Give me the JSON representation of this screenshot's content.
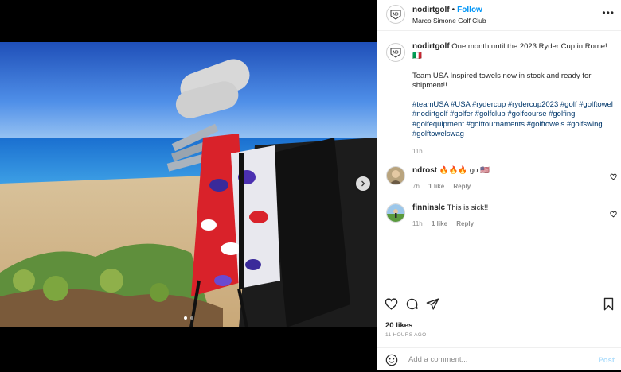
{
  "header": {
    "username": "nodirtgolf",
    "follow_label": "Follow",
    "location": "Marco Simone Golf Club",
    "more_label": "•••"
  },
  "avatar": {
    "monogram": "ND"
  },
  "caption": {
    "username": "nodirtgolf",
    "line1": "One month until the 2023 Ryder Cup in Rome! 🇮🇹",
    "line2": "Team USA Inspired towels now in stock and ready for shipment!!",
    "hashtags": "#teamUSA #USA #rydercup #rydercup2023 #golf #golftowel #nodirtgolf #golfer #golfclub #golfcourse #golfing #golfequipment #golftournaments #golftowels #golfswing #golftowelswag",
    "time": "11h"
  },
  "comments": [
    {
      "username": "ndrost",
      "text": "🔥🔥🔥 go 🇺🇸",
      "time": "7h",
      "likes": "1 like",
      "reply": "Reply"
    },
    {
      "username": "finninslc",
      "text": "This is sick!!",
      "time": "11h",
      "likes": "1 like",
      "reply": "Reply"
    }
  ],
  "post": {
    "likes": "20 likes",
    "time_ago": "11 HOURS AGO"
  },
  "add_comment": {
    "placeholder": "Add a comment...",
    "post_label": "Post"
  },
  "colors": {
    "link_blue": "#0095f6",
    "hashtag_blue": "#00376b",
    "muted": "#8e8e8e",
    "post_disabled": "#b2dffc"
  },
  "carousel": {
    "slide_count": 2,
    "active_index": 0
  },
  "icons": [
    "more-icon",
    "next-arrow-icon",
    "heart-icon",
    "comment-icon",
    "share-icon",
    "bookmark-icon",
    "emoji-icon"
  ]
}
